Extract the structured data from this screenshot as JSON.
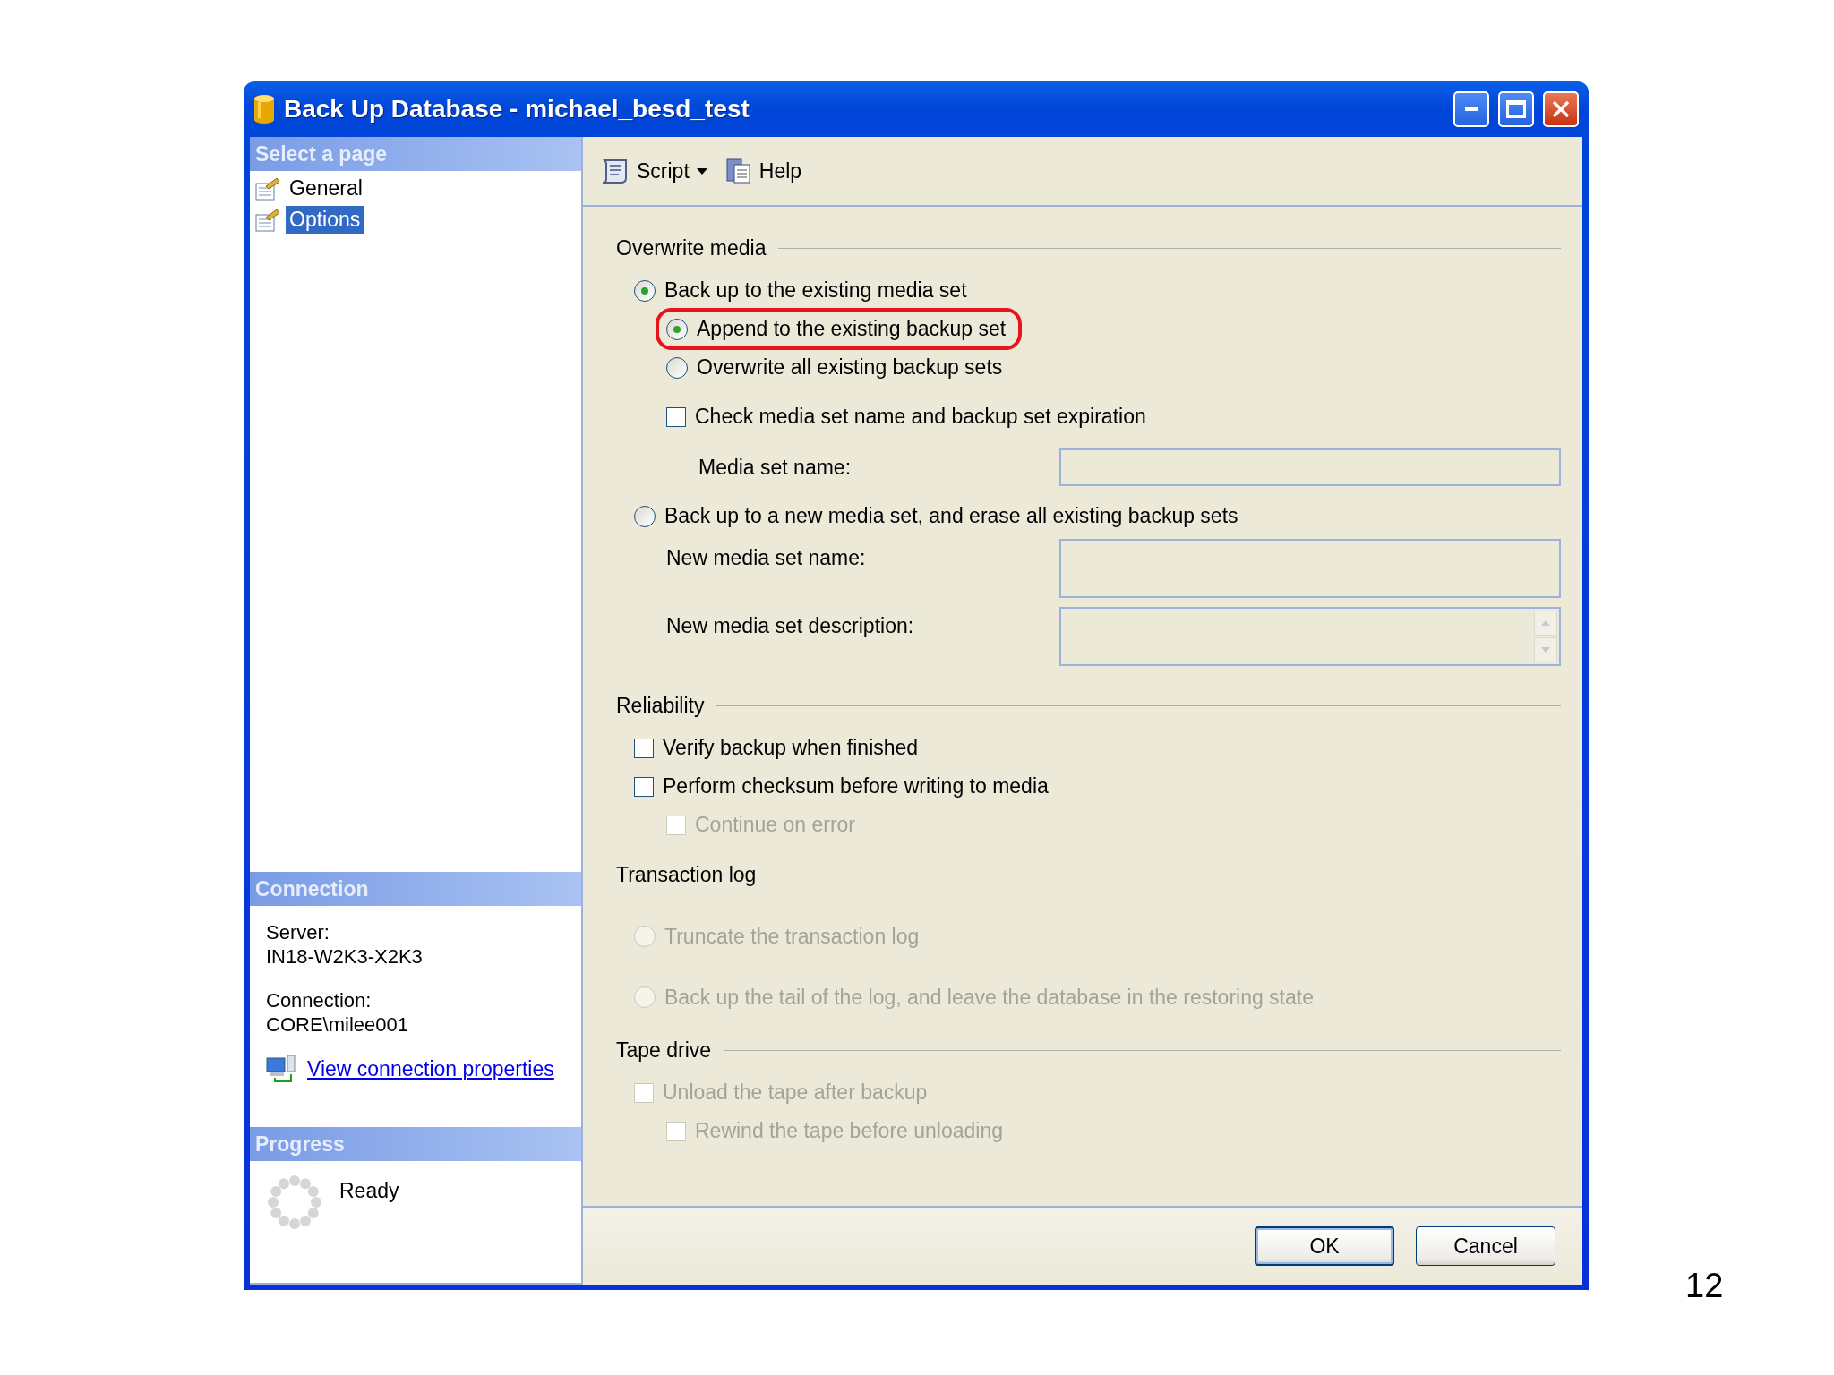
{
  "window": {
    "title": "Back Up Database - michael_besd_test"
  },
  "sidebar": {
    "header": "Select a page",
    "pages": [
      {
        "label": "General",
        "selected": false
      },
      {
        "label": "Options",
        "selected": true
      }
    ],
    "connection": {
      "header": "Connection",
      "server_label": "Server:",
      "server": "IN18-W2K3-X2K3",
      "connection_label": "Connection:",
      "connection": "CORE\\milee001",
      "link": "View connection properties"
    },
    "progress": {
      "header": "Progress",
      "status": "Ready"
    }
  },
  "toolbar": [
    {
      "kind": "script",
      "label": "Script"
    },
    {
      "kind": "help",
      "label": "Help"
    }
  ],
  "sections": [
    {
      "title": "Overwrite media",
      "items": [
        {
          "kind": "radio",
          "label": "Back up to the existing media set",
          "selected": true,
          "disabled": false,
          "children": [
            {
              "kind": "radio",
              "label": "Append to the existing backup set",
              "selected": true,
              "disabled": false,
              "highlighted": true
            },
            {
              "kind": "radio",
              "label": "Overwrite all existing backup sets",
              "selected": false,
              "disabled": false,
              "highlighted": false
            },
            {
              "kind": "checkbox",
              "label": "Check media set name and backup set expiration",
              "checked": false,
              "disabled": false,
              "children": [
                {
                  "kind": "field",
                  "label": "Media set name:"
                }
              ]
            }
          ]
        },
        {
          "kind": "radio",
          "label": "Back up to a new media set, and erase all existing backup sets",
          "selected": false,
          "disabled": false,
          "children": [
            {
              "kind": "box",
              "label": "New media set name:"
            },
            {
              "kind": "memo",
              "label": "New media set description:"
            }
          ]
        }
      ]
    },
    {
      "title": "Reliability",
      "items": [
        {
          "kind": "checkbox",
          "label": "Verify backup when finished",
          "checked": false,
          "disabled": false
        },
        {
          "kind": "checkbox",
          "label": "Perform checksum before writing to media",
          "checked": false,
          "disabled": false,
          "children": [
            {
              "kind": "checkbox",
              "label": "Continue on error",
              "checked": false,
              "disabled": true
            }
          ]
        }
      ]
    },
    {
      "title": "Transaction log",
      "items": [
        {
          "kind": "radio",
          "label": "Truncate the transaction log",
          "selected": false,
          "disabled": true
        },
        {
          "kind": "radio",
          "label": "Back up the tail of the log, and leave the database in the restoring state",
          "selected": false,
          "disabled": true
        }
      ]
    },
    {
      "title": "Tape drive",
      "items": [
        {
          "kind": "checkbox",
          "label": "Unload the tape after backup",
          "checked": false,
          "disabled": true,
          "children": [
            {
              "kind": "checkbox",
              "label": "Rewind the tape before unloading",
              "checked": false,
              "disabled": true
            }
          ]
        }
      ]
    }
  ],
  "buttons": [
    {
      "label": "OK",
      "default": true
    },
    {
      "label": "Cancel",
      "default": false
    }
  ],
  "page_number": "12"
}
